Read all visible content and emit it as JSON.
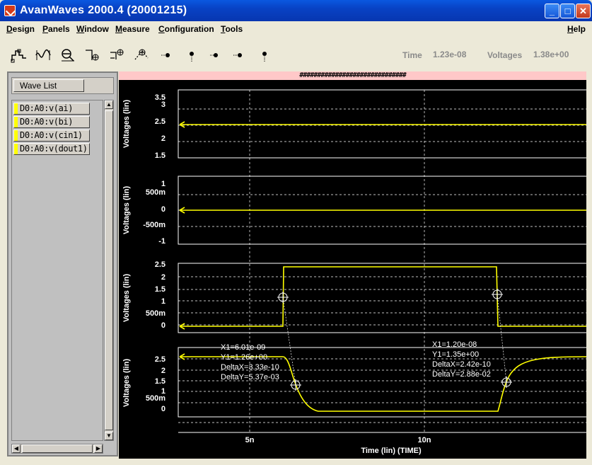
{
  "window": {
    "title": "AvanWaves 2000.4  (20001215)",
    "min_glyph": "_",
    "max_glyph": "□",
    "close_glyph": "✕"
  },
  "menu": {
    "design": "Design",
    "panels": "Panels",
    "window": "Window",
    "measure": "Measure",
    "configuration": "Configuration",
    "tools": "Tools",
    "help": "Help"
  },
  "toolbar": {
    "icons": [
      "waveform-stack-icon",
      "fit-waveform-icon",
      "zoom-in-icon",
      "zoom-box-icon",
      "zoom-cursor-icon",
      "measure-icon",
      "point-marker-icon",
      "point-marker-down-icon",
      "point-marker-left-icon",
      "point-marker-right-icon",
      "point-marker-up-icon"
    ],
    "time_label": "Time",
    "time_value": "1.23e-08",
    "voltages_label": "Voltages",
    "voltages_value": "1.38e+00"
  },
  "wave_list": {
    "header": "Wave List",
    "items": [
      "D0:A0:v(ai)",
      "D0:A0:v(bi)",
      "D0:A0:v(cin1)",
      "D0:A0:v(dout1)"
    ],
    "swatch_color": "#ffff00"
  },
  "plot": {
    "hash_bar": "##############################",
    "trace_color": "#ffff00",
    "x_axis_label": "Time (lin) (TIME)",
    "x_ticks": [
      "5n",
      "10n"
    ],
    "panels": [
      {
        "ylabel": "Voltages (lin)",
        "ticks": [
          "3.5",
          "3",
          "2.5",
          "2",
          "1.5"
        ]
      },
      {
        "ylabel": "Voltages (lin)",
        "ticks": [
          "1",
          "500m",
          "0",
          "-500m",
          "-1"
        ]
      },
      {
        "ylabel": "Voltages (lin)",
        "ticks": [
          "2.5",
          "2",
          "1.5",
          "1",
          "500m",
          "0"
        ]
      },
      {
        "ylabel": "Voltages (lin)",
        "ticks": [
          "2.5",
          "2",
          "1.5",
          "1",
          "500m",
          "0"
        ]
      }
    ],
    "measurements": [
      {
        "x1": "X1=6.01e-09",
        "y1": "Y1=1.26e+00",
        "dx": "DeltaX=3.33e-10",
        "dy": "DeltaY=5.37e-03"
      },
      {
        "x1": "X1=1.20e-08",
        "y1": "Y1=1.35e+00",
        "dx": "DeltaX=2.42e-10",
        "dy": "DeltaY=2.88e-02"
      }
    ]
  }
}
